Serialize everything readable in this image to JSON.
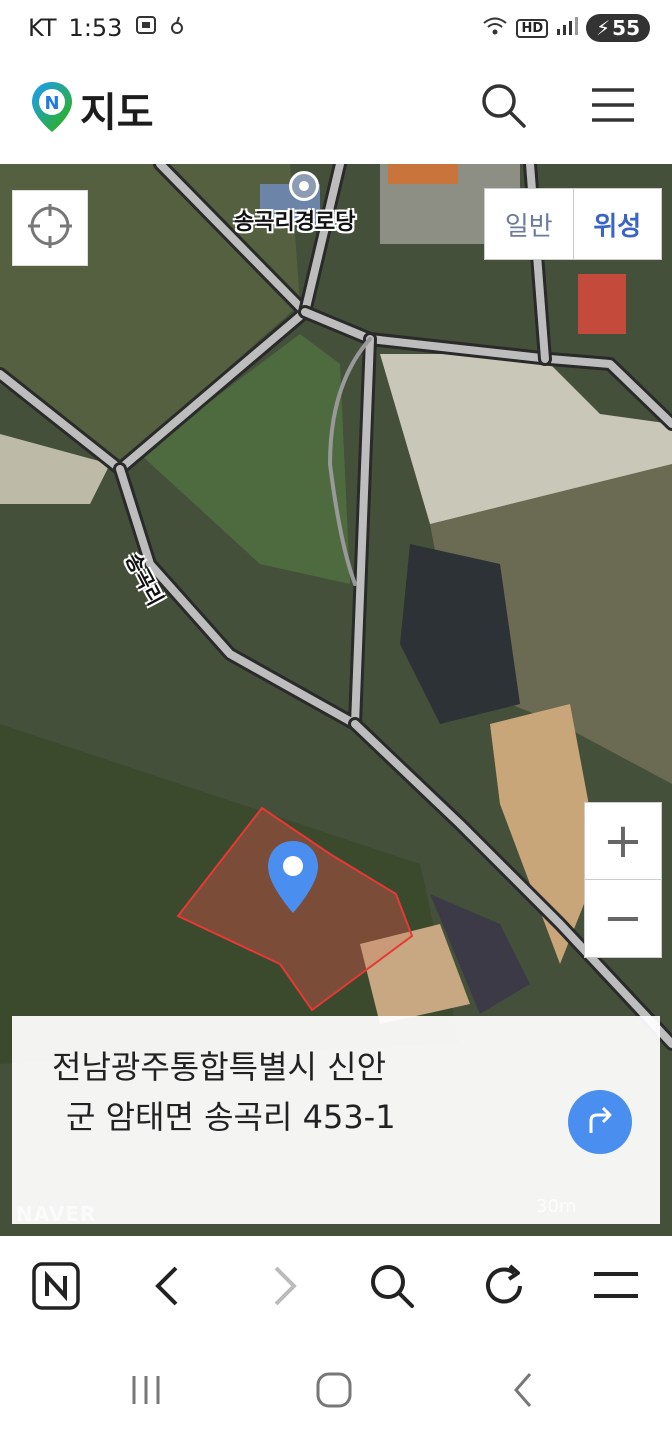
{
  "status": {
    "carrier": "KT",
    "time": "1:53",
    "network": "HD",
    "battery": "55"
  },
  "app": {
    "logo_letter": "N",
    "title": "지도"
  },
  "map": {
    "type_general": "일반",
    "type_satellite": "위성",
    "poi_name": "송곡리경로당",
    "road_name": "송곡리",
    "zoom_in": "+",
    "zoom_out": "−",
    "watermark": "NAVER",
    "scale": "30m"
  },
  "address": {
    "line1": "전남광주통합특별시 신안",
    "line2": "군 암태면 송곡리 453-1"
  },
  "colors": {
    "accent": "#4a8ff0",
    "logo_green": "#2db400",
    "parcel_outline": "#e53935"
  },
  "icons": [
    "crosshair-icon",
    "search-icon",
    "menu-icon",
    "route-icon",
    "back-icon",
    "forward-icon",
    "refresh-icon",
    "home-icon",
    "recent-apps-icon"
  ]
}
